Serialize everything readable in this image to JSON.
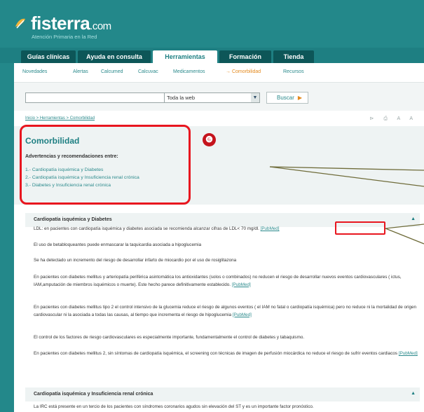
{
  "header": {
    "logo_name": "fisterra",
    "logo_domain": ".com",
    "tagline": "Atención Primaria en la Red"
  },
  "mainnav": {
    "tabs": [
      {
        "label": "Guías clínicas",
        "active": false
      },
      {
        "label": "Ayuda en consulta",
        "active": false
      },
      {
        "label": "Herramientas",
        "active": true
      },
      {
        "label": "Formación",
        "active": false
      },
      {
        "label": "Tienda",
        "active": false
      }
    ]
  },
  "subnav": {
    "items": [
      {
        "label": "Novedades",
        "active": false
      },
      {
        "label": "Alertas",
        "active": false
      },
      {
        "label": "Calcumed",
        "active": false
      },
      {
        "label": "Calcuvac",
        "active": false
      },
      {
        "label": "Medicamentos",
        "active": false
      },
      {
        "label": "→ Comorbilidad",
        "active": true
      },
      {
        "label": "Recursos",
        "active": false
      }
    ]
  },
  "search": {
    "value": "",
    "scope_selected": "Toda la web",
    "button_label": "Buscar"
  },
  "breadcrumb": "Inicio > Herramientas > Comorbilidad",
  "tools": "⊳ ⎙ A A",
  "page": {
    "title": "Comorbilidad",
    "advert_heading": "Advertencias y recomendaciones entre:",
    "toc": [
      "1.- Cardiopatía isquémica y Diabetes",
      "2.- Cardiopatía isquémica y Insuficiencia renal crónica",
      "3.- Diabetes y Insuficiencia renal crónica"
    ]
  },
  "annotation": {
    "badge": "❻",
    "color": "#e8161f"
  },
  "sections": [
    {
      "title": "Cardiopatía isquémica y Diabetes",
      "collapse_icon": "▲",
      "paragraphs": [
        {
          "text": "LDL: en pacientes con cardiopatía isquémica y diabetes asociada se recomienda alcanzar cifras de LDL< 70 mg/dl.",
          "link": "[PubMed]"
        },
        {
          "text": "El uso de betabloqueantes puede enmascarar la taquicardia asociada a hipoglucemia",
          "link": ""
        },
        {
          "text": "Se ha detectado un incremento del riesgo de desarrollar infarto de miocardio por el uso de rosiglitazona",
          "link": ""
        },
        {
          "text": "En pacientes con diabetes mellitus y arteriopatía periférica asintomática los antioxidantes (solos o combinados) no reducen el riesgo de desarrollar nuevos eventos cardiovasculares ( ictus, IAM,amputación de miembros isquémicos o muerte). Este hecho parece definitivamente establecido.",
          "link": "[PubMed]"
        },
        {
          "text": "En pacientes con diabetes mellitus tipo 2 el control intensivo de la glucemia reduce el riesgo de algunos eventos ( el IAM no fatal o cardiopatía isquémica) pero no reduce ni la mortalidad de origen cardiovascular ni la asociada a todas las causas, al tiempo que incrementa el riesgo de hipoglucemia",
          "link": "[PubMed]"
        },
        {
          "text": "El control de los factores de riesgo cardiovasculares es especialmente importante, fundamentalmente el control de diabetes y tabaquismo.",
          "link": ""
        },
        {
          "text": "En pacientes con diabetes mellitus 2, sin síntomas de cardiopatía isquémica, el screening con técnicas de imagen de perfusión miocárdica no reduce el riesgo de sufrir eventos cardiacos",
          "link": "[PubMed]"
        }
      ]
    },
    {
      "title": "Cardiopatía isquémica y Insuficiencia renal crónica",
      "collapse_icon": "▲",
      "paragraphs": [
        {
          "text": "La IRC está presente en un tercio de los pacientes con síndromes coronarios agudos sin elevación del ST y es un importante factor pronóstico.",
          "link": ""
        }
      ]
    }
  ]
}
